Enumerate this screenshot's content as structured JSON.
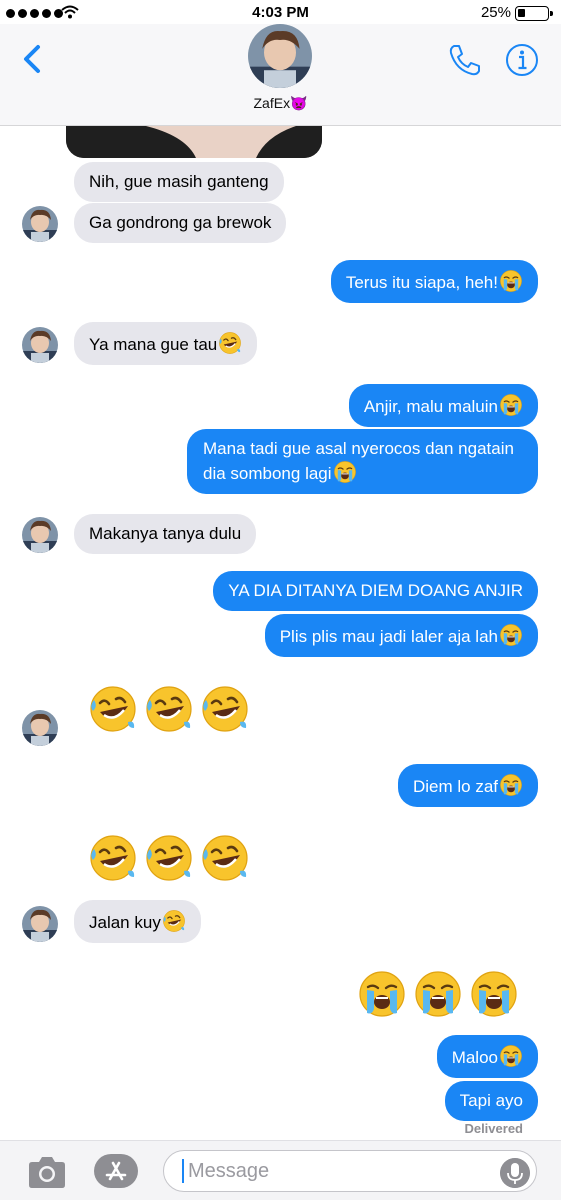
{
  "status_bar": {
    "time": "4:03 PM",
    "battery": "25%",
    "icons": [
      "signal-dots-icon",
      "wifi-icon",
      "battery-icon"
    ]
  },
  "header": {
    "contact_name": "ZafEx👿",
    "icons": [
      "back-chevron-icon",
      "phone-icon",
      "info-icon"
    ],
    "accent_color": "#1a86f5"
  },
  "messages": [
    {
      "side": "in",
      "text": "Nih, gue masih ganteng"
    },
    {
      "side": "in",
      "text": "Ga gondrong ga brewok"
    },
    {
      "side": "out",
      "text": "Terus itu siapa, heh!",
      "emoji": "crying"
    },
    {
      "side": "in",
      "text": "Ya mana gue tau",
      "emoji": "rofl"
    },
    {
      "side": "out",
      "text": "Anjir, malu maluin",
      "emoji": "crying"
    },
    {
      "side": "out",
      "text": "Mana tadi gue asal nyerocos dan ngatain dia sombong lagi",
      "emoji": "crying"
    },
    {
      "side": "in",
      "text": "Makanya tanya dulu"
    },
    {
      "side": "out",
      "text": "YA DIA DITANYA DIEM DOANG ANJIR"
    },
    {
      "side": "out",
      "text": "Plis plis mau jadi laler aja lah",
      "emoji": "crying"
    },
    {
      "side": "in",
      "big_emoji": [
        "rofl",
        "rofl",
        "rofl"
      ]
    },
    {
      "side": "out",
      "text": "Diem lo zaf",
      "emoji": "crying"
    },
    {
      "side": "in",
      "big_emoji": [
        "rofl",
        "rofl",
        "rofl"
      ]
    },
    {
      "side": "in",
      "text": "Jalan kuy",
      "emoji": "rofl"
    },
    {
      "side": "out",
      "big_emoji": [
        "crying",
        "crying",
        "crying"
      ]
    },
    {
      "side": "out",
      "text": "Maloo",
      "emoji": "crying"
    },
    {
      "side": "out",
      "text": "Tapi ayo"
    }
  ],
  "delivered_label": "Delivered",
  "input_bar": {
    "placeholder": "Message",
    "icons": [
      "camera-icon",
      "app-store-icon",
      "microphone-icon"
    ]
  },
  "colors": {
    "outgoing_bubble": "#1a86f5",
    "incoming_bubble": "#e6e6ec"
  }
}
